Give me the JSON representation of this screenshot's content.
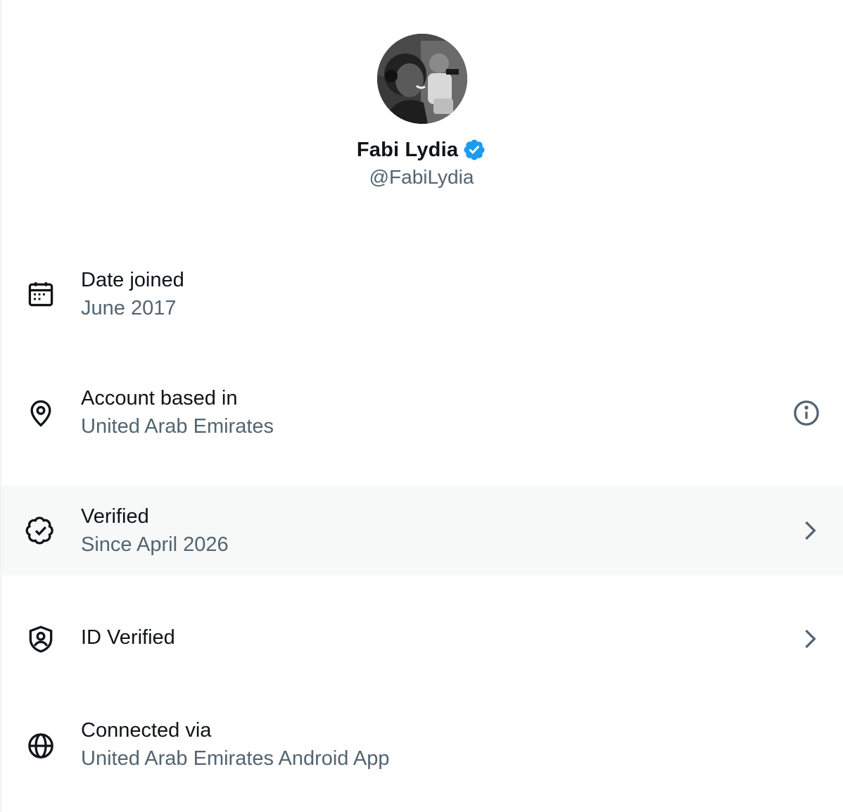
{
  "profile": {
    "name": "Fabi Lydia",
    "handle": "@FabiLydia",
    "verified": true,
    "badge_color": "#1d9bf0"
  },
  "rows": [
    {
      "icon": "calendar-icon",
      "title": "Date joined",
      "subtitle": "June 2017",
      "action": null
    },
    {
      "icon": "location-pin-icon",
      "title": "Account based in",
      "subtitle": "United Arab Emirates",
      "action": "info-icon"
    },
    {
      "icon": "verified-check-icon",
      "title": "Verified",
      "subtitle": "Since April 2026",
      "action": "chevron-right-icon",
      "highlighted": true
    },
    {
      "icon": "id-shield-icon",
      "title": "ID Verified",
      "subtitle": "",
      "action": "chevron-right-icon"
    },
    {
      "icon": "globe-icon",
      "title": "Connected via",
      "subtitle": "United Arab Emirates Android App",
      "action": null
    }
  ],
  "colors": {
    "primary_text": "#0f1419",
    "secondary_text": "#536471",
    "highlight_bg": "#f7f9f9"
  }
}
